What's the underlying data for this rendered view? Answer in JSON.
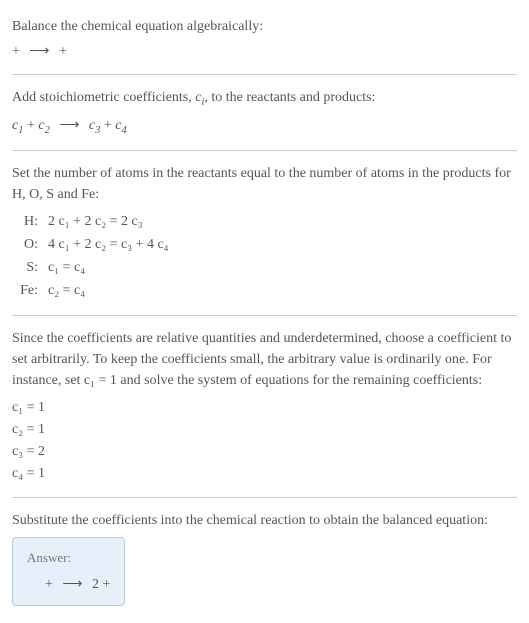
{
  "intro": {
    "line1": "Balance the chemical equation algebraically:",
    "eq_left": "  + ",
    "arrow": "⟶",
    "eq_right": "  + "
  },
  "stoich": {
    "text_before": "Add stoichiometric coefficients, ",
    "ci": "c",
    "ci_sub": "i",
    "text_after": ", to the reactants and products:",
    "c1": "c",
    "c1_sub": "1",
    "plus1": "  + ",
    "c2": "c",
    "c2_sub": "2",
    "arrow": "⟶",
    "c3": "c",
    "c3_sub": "3",
    "plus2": "  + ",
    "c4": "c",
    "c4_sub": "4"
  },
  "atoms": {
    "intro": "Set the number of atoms in the reactants equal to the number of atoms in the products for H, O, S and Fe:",
    "rows": [
      {
        "label": "H:",
        "eq": "2 c₁ + 2 c₂ = 2 c₃"
      },
      {
        "label": "O:",
        "eq": "4 c₁ + 2 c₂ = c₃ + 4 c₄"
      },
      {
        "label": "S:",
        "eq": "c₁ = c₄"
      },
      {
        "label": "Fe:",
        "eq": "c₂ = c₄"
      }
    ]
  },
  "solve": {
    "intro": "Since the coefficients are relative quantities and underdetermined, choose a coefficient to set arbitrarily. To keep the coefficients small, the arbitrary value is ordinarily one. For instance, set c₁ = 1 and solve the system of equations for the remaining coefficients:",
    "coeffs": [
      "c₁ = 1",
      "c₂ = 1",
      "c₃ = 2",
      "c₄ = 1"
    ]
  },
  "substitute": {
    "intro": "Substitute the coefficients into the chemical reaction to obtain the balanced equation:"
  },
  "answer": {
    "label": "Answer:",
    "eq_left": " + ",
    "arrow": "⟶",
    "eq_mid": " 2 ",
    "eq_right": " + "
  }
}
